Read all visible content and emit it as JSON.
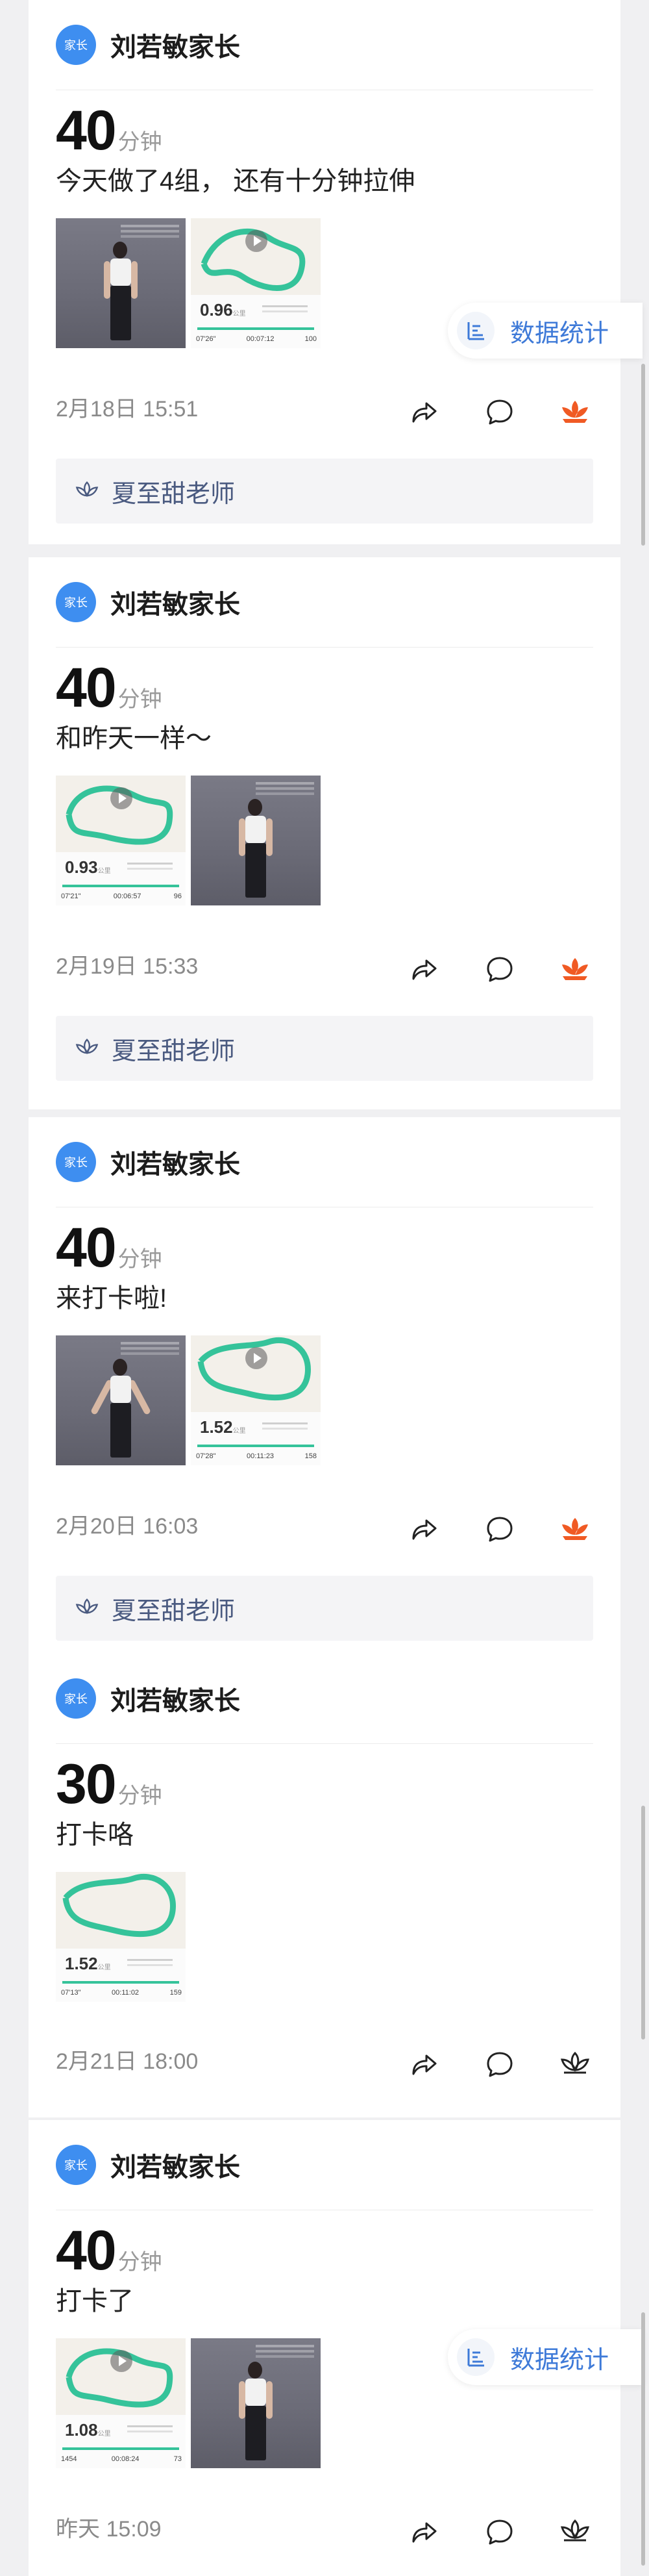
{
  "posts": [
    {
      "user": "刘若敏家长",
      "role": "家长",
      "duration": "40",
      "unit": "分钟",
      "caption": "今天做了4组， 还有十分钟拉伸",
      "time": "2月18日 15:51",
      "teacher": "夏至甜老师",
      "maps": [
        {
          "dist": "0.96",
          "dist_unit": "公里",
          "f1": "07'26\"",
          "f2": "00:07:12",
          "f3": "100"
        }
      ]
    },
    {
      "user": "刘若敏家长",
      "role": "家长",
      "duration": "40",
      "unit": "分钟",
      "caption": "和昨天一样～",
      "time": "2月19日 15:33",
      "teacher": "夏至甜老师",
      "maps": [
        {
          "dist": "0.93",
          "dist_unit": "公里",
          "f1": "07'21\"",
          "f2": "00:06:57",
          "f3": "96"
        }
      ]
    },
    {
      "user": "刘若敏家长",
      "role": "家长",
      "duration": "40",
      "unit": "分钟",
      "caption": "来打卡啦!",
      "time": "2月20日 16:03",
      "teacher": "夏至甜老师",
      "maps": [
        {
          "dist": "1.52",
          "dist_unit": "公里",
          "f1": "07'28\"",
          "f2": "00:11:23",
          "f3": "158"
        }
      ]
    },
    {
      "user": "刘若敏家长",
      "role": "家长",
      "duration": "30",
      "unit": "分钟",
      "caption": "打卡咯",
      "time": "2月21日 18:00",
      "maps": [
        {
          "dist": "1.52",
          "dist_unit": "公里",
          "f1": "07'13\"",
          "f2": "00:11:02",
          "f3": "159"
        }
      ]
    },
    {
      "user": "刘若敏家长",
      "role": "家长",
      "duration": "40",
      "unit": "分钟",
      "caption": "打卡了",
      "time": "昨天 15:09",
      "maps": [
        {
          "dist": "1.08",
          "dist_unit": "公里",
          "f1": "1454",
          "f2": "00:08:24",
          "f3": "73"
        }
      ]
    }
  ],
  "stats_button": {
    "label": "数据统计"
  },
  "icons": {
    "share": "share-icon",
    "comment": "comment-icon",
    "like": "lotus-icon",
    "stats": "bar-list-icon",
    "teacher": "lotus-outline-icon"
  },
  "colors": {
    "accent": "#3e8ef0",
    "liked": "#f05a24",
    "stats": "#3e7ad8"
  }
}
